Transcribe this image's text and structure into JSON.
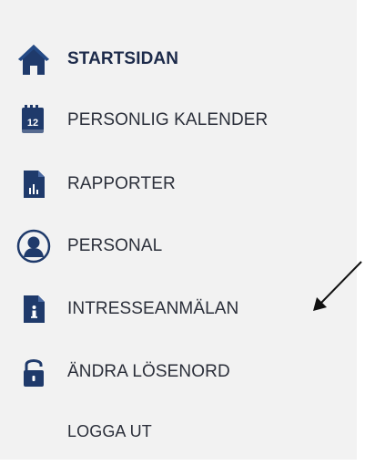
{
  "menu": {
    "items": [
      {
        "label": "STARTSIDAN",
        "icon": "home-icon"
      },
      {
        "label": "PERSONLIG KALENDER",
        "icon": "calendar-icon",
        "icon_text": "12"
      },
      {
        "label": "RAPPORTER",
        "icon": "report-icon"
      },
      {
        "label": "PERSONAL",
        "icon": "person-icon"
      },
      {
        "label": "INTRESSEANMÄLAN",
        "icon": "info-document-icon"
      },
      {
        "label": "ÄNDRA LÖSENORD",
        "icon": "lock-icon"
      },
      {
        "label": "LOGGA UT",
        "icon": ""
      }
    ]
  },
  "colors": {
    "icon": "#1f3a6b",
    "text": "#2b2f3a",
    "panel": "#f2f2f2"
  }
}
